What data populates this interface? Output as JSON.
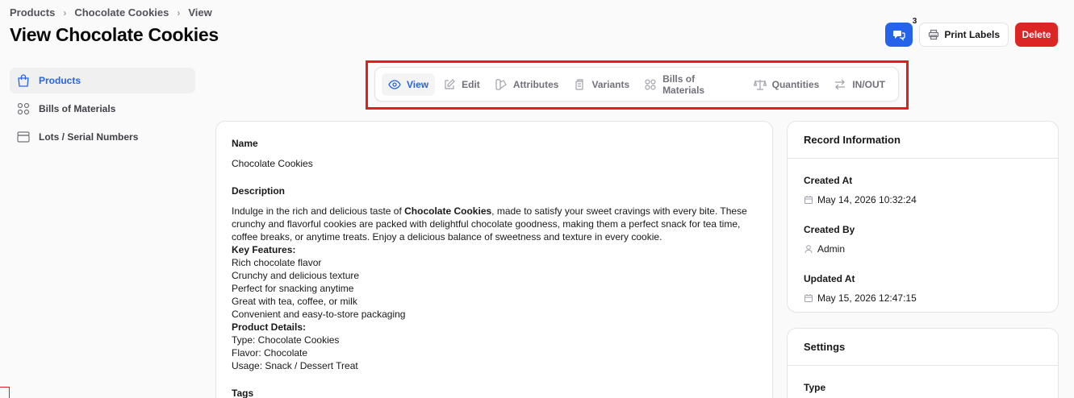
{
  "breadcrumb": [
    "Products",
    "Chocolate Cookies",
    "View"
  ],
  "page_title": "View Chocolate Cookies",
  "header": {
    "notification_count": "3",
    "print_label": "Print Labels",
    "delete_label": "Delete"
  },
  "sidebar": {
    "items": [
      {
        "label": "Products",
        "icon": "shopping-bag-icon",
        "active": true
      },
      {
        "label": "Bills of Materials",
        "icon": "grid-icon",
        "active": false
      },
      {
        "label": "Lots / Serial Numbers",
        "icon": "archive-icon",
        "active": false
      }
    ]
  },
  "tabs": [
    {
      "label": "View",
      "icon": "eye-icon",
      "active": true
    },
    {
      "label": "Edit",
      "icon": "pencil-square-icon"
    },
    {
      "label": "Attributes",
      "icon": "swatch-icon"
    },
    {
      "label": "Variants",
      "icon": "copy-icon"
    },
    {
      "label": "Bills of Materials",
      "icon": "grid-icon"
    },
    {
      "label": "Quantities",
      "icon": "scale-icon"
    },
    {
      "label": "IN/OUT",
      "icon": "arrows-right-left-icon"
    }
  ],
  "main": {
    "name_label": "Name",
    "name_value": "Chocolate Cookies",
    "description_label": "Description",
    "desc_intro_pre": "Indulge in the rich and delicious taste of ",
    "desc_intro_bold": "Chocolate Cookies",
    "desc_intro_post": ", made to satisfy your sweet cravings with every bite. These crunchy and flavorful cookies are packed with delightful chocolate goodness, making them a perfect snack for tea time, coffee breaks, or anytime treats. Enjoy a delicious balance of sweetness and texture in every cookie.",
    "key_features_heading": "Key Features:",
    "key_features": [
      "Rich chocolate flavor",
      "Crunchy and delicious texture",
      "Perfect for snacking anytime",
      "Great with tea, coffee, or milk",
      "Convenient and easy-to-store packaging"
    ],
    "product_details_heading": "Product Details:",
    "product_details": [
      "Type: Chocolate Cookies",
      "Flavor: Chocolate",
      "Usage: Snack / Dessert Treat"
    ],
    "tags_label": "Tags"
  },
  "record_info": {
    "title": "Record Information",
    "created_at_label": "Created At",
    "created_at": "May 14, 2026 10:32:24",
    "created_by_label": "Created By",
    "created_by": "Admin",
    "updated_at_label": "Updated At",
    "updated_at": "May 15, 2026 12:47:15"
  },
  "settings": {
    "title": "Settings",
    "type_label": "Type"
  },
  "colors": {
    "accent": "#2563eb",
    "danger": "#dc2626",
    "highlight": "#e11d1d"
  }
}
